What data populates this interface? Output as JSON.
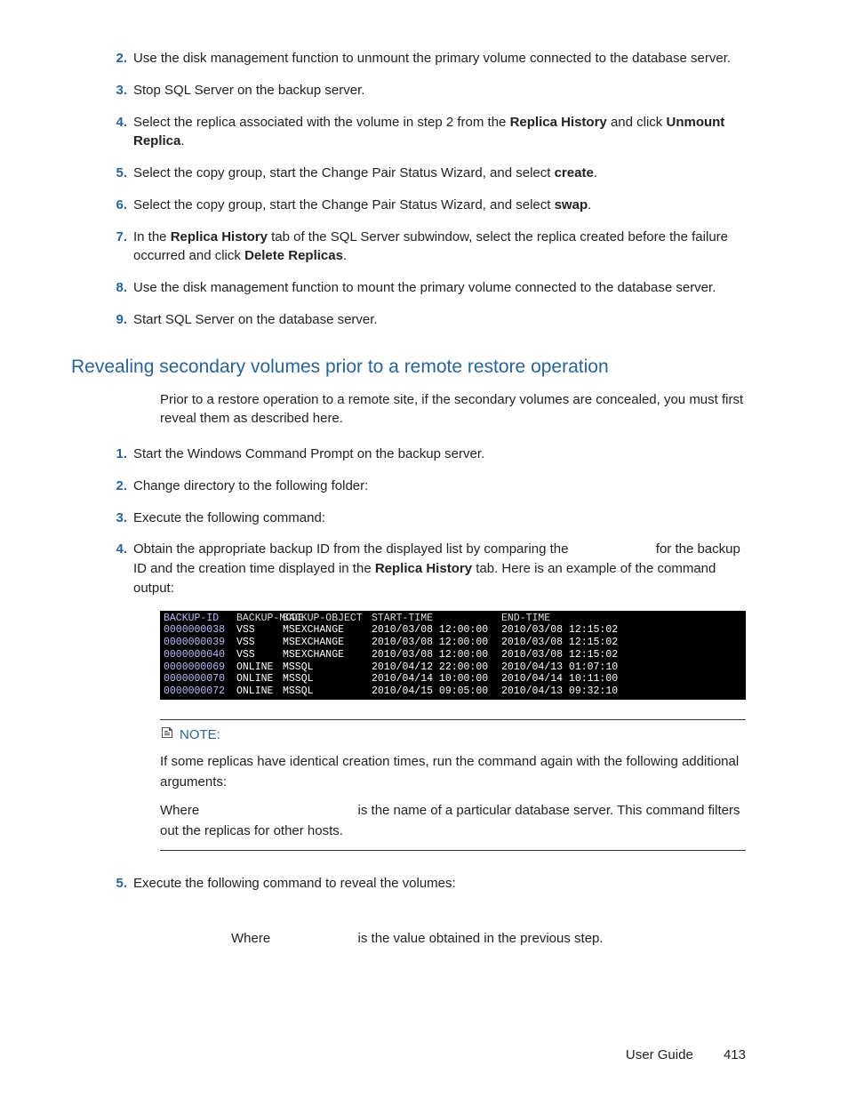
{
  "list1": {
    "items": [
      {
        "n": "2.",
        "parts": [
          "Use the disk management function to unmount the primary volume connected to the database server."
        ]
      },
      {
        "n": "3.",
        "parts": [
          "Stop SQL Server on the backup server."
        ]
      },
      {
        "n": "4.",
        "parts": [
          "Select the replica associated with the volume in step 2 from the ",
          {
            "b": "Replica History"
          },
          " and click ",
          {
            "b": "Unmount Replica"
          },
          "."
        ]
      },
      {
        "n": "5.",
        "parts": [
          "Select the copy group, start the Change Pair Status Wizard, and select ",
          {
            "b": "create"
          },
          "."
        ]
      },
      {
        "n": "6.",
        "parts": [
          "Select the copy group, start the Change Pair Status Wizard, and select ",
          {
            "b": "swap"
          },
          "."
        ]
      },
      {
        "n": "7.",
        "parts": [
          "In the ",
          {
            "b": "Replica History"
          },
          " tab of the SQL Server subwindow, select the replica created before the failure occurred and click ",
          {
            "b": "Delete Replicas"
          },
          "."
        ]
      },
      {
        "n": "8.",
        "parts": [
          "Use the disk management function to mount the primary volume connected to the database server."
        ]
      },
      {
        "n": "9.",
        "parts": [
          "Start SQL Server on the database server."
        ]
      }
    ]
  },
  "section_heading": "Revealing secondary volumes prior to a remote restore operation",
  "intro": "Prior to a restore operation to a remote site, if the secondary volumes are concealed, you must first reveal them as described here.",
  "list2": {
    "items": [
      {
        "n": "1.",
        "parts": [
          "Start the Windows Command Prompt on the backup server."
        ]
      },
      {
        "n": "2.",
        "parts": [
          "Change directory to the following folder:"
        ]
      },
      {
        "n": "3.",
        "parts": [
          "Execute the following command:"
        ]
      },
      {
        "n": "4.",
        "parts": [
          "Obtain the appropriate backup ID from the displayed list by comparing the ",
          {
            "gap": true
          },
          " for the backup ID and the creation time displayed in the ",
          {
            "b": "Replica History"
          },
          " tab. Here is an example of the command output:"
        ]
      }
    ]
  },
  "cmd_table": {
    "headers": [
      "BACKUP-ID",
      "BACKUP-MODE",
      "BACKUP-OBJECT",
      "START-TIME",
      "END-TIME"
    ],
    "rows": [
      [
        "0000000038",
        "VSS",
        "MSEXCHANGE",
        "2010/03/08 12:00:00",
        "2010/03/08 12:15:02"
      ],
      [
        "0000000039",
        "VSS",
        "MSEXCHANGE",
        "2010/03/08 12:00:00",
        "2010/03/08 12:15:02"
      ],
      [
        "0000000040",
        "VSS",
        "MSEXCHANGE",
        "2010/03/08 12:00:00",
        "2010/03/08 12:15:02"
      ],
      [
        "0000000069",
        "ONLINE",
        "MSSQL",
        "2010/04/12 22:00:00",
        "2010/04/13 01:07:10"
      ],
      [
        "0000000070",
        "ONLINE",
        "MSSQL",
        "2010/04/14 10:00:00",
        "2010/04/14 10:11:00"
      ],
      [
        "0000000072",
        "ONLINE",
        "MSSQL",
        "2010/04/15 09:05:00",
        "2010/04/13 09:32:10"
      ]
    ]
  },
  "note": {
    "label": "NOTE:",
    "p1": "If some replicas have identical creation times, run the command again with the following additional arguments:",
    "p2a": "Where ",
    "p2b": " is the name of a particular database server. This command filters out the replicas for other hosts."
  },
  "list3": {
    "items": [
      {
        "n": "5.",
        "parts": [
          "Execute the following command to reveal the volumes:"
        ]
      }
    ]
  },
  "tail_a": "Where ",
  "tail_b": " is the value obtained in the previous step.",
  "footer": {
    "title": "User Guide",
    "page": "413"
  }
}
